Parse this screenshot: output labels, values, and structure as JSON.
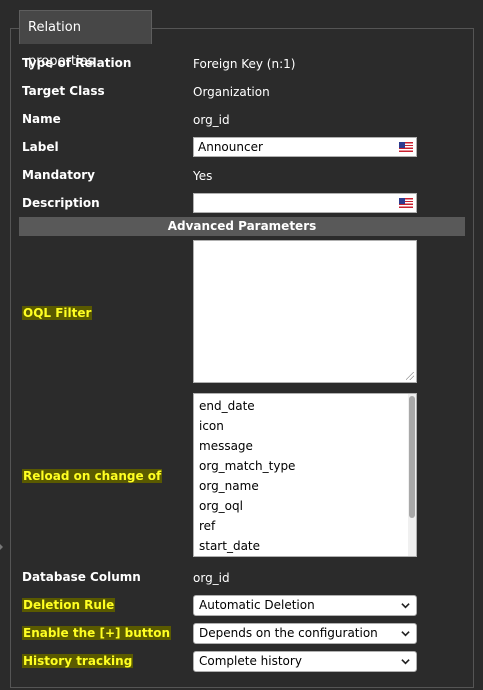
{
  "legend": "Relation properties",
  "fields": {
    "type_of_relation": {
      "label": "Type of Relation",
      "value": "Foreign Key (n:1)"
    },
    "target_class": {
      "label": "Target Class",
      "value": "Organization"
    },
    "name": {
      "label": "Name",
      "value": "org_id"
    },
    "label": {
      "label": "Label",
      "value": "Announcer"
    },
    "mandatory": {
      "label": "Mandatory",
      "value": "Yes"
    },
    "description": {
      "label": "Description",
      "value": ""
    }
  },
  "advanced_banner": "Advanced Parameters",
  "oql_filter": {
    "label": "OQL Filter",
    "value": ""
  },
  "reload": {
    "label": "Reload on change of",
    "options": [
      "end_date",
      "icon",
      "message",
      "org_match_type",
      "org_name",
      "org_oql",
      "ref",
      "start_date"
    ]
  },
  "database_column": {
    "label": "Database Column",
    "value": "org_id"
  },
  "deletion_rule": {
    "label": "Deletion Rule",
    "value": "Automatic Deletion"
  },
  "enable_plus": {
    "label": "Enable the [+] button",
    "value": "Depends on the configuration"
  },
  "history": {
    "label": "History tracking",
    "value": "Complete history"
  },
  "colors": {
    "background": "#2b2b2b",
    "highlight": "#5a5a00",
    "highlight_text": "#ffff22",
    "banner": "#595959"
  },
  "icons": {
    "flag": "us-flag-icon",
    "dropdown": "chevron-down-icon",
    "resize": "resize-grip-icon"
  }
}
